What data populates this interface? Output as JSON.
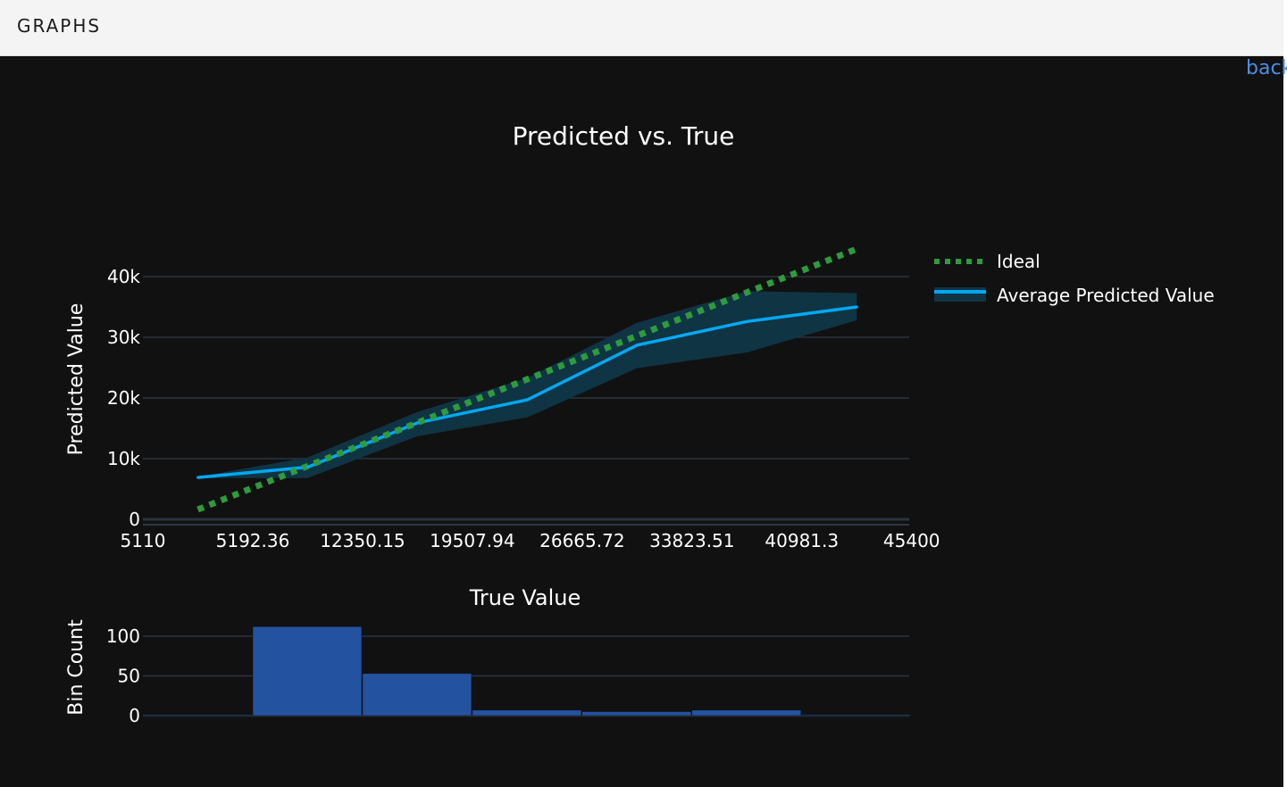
{
  "header": {
    "title": "GRAPHS"
  },
  "nav": {
    "back_label": "back"
  },
  "colors": {
    "background": "#111111",
    "ideal": "#2e9b3e",
    "predicted": "#00a8f3",
    "band": "#0f3443",
    "bars": "#2352a0",
    "grid": "#2a3441",
    "text": "#ffffff"
  },
  "chart_data": [
    {
      "type": "line",
      "title": "Predicted vs. True",
      "xlabel": "",
      "ylabel": "Predicted Value",
      "xlim": [
        -1967.79,
        47980.7
      ],
      "ylim": [
        0,
        40000
      ],
      "x_tick_values": [
        -1967.79,
        5192.36,
        12350.15,
        19507.94,
        26665.72,
        33823.51,
        40981.3,
        48139.09
      ],
      "x_tick_labels": [
        "5110",
        "5192.36",
        "12350.15",
        "19507.94",
        "26665.72",
        "33823.51",
        "40981.3",
        "45400"
      ],
      "y_ticks": [
        0,
        10000,
        20000,
        30000,
        40000
      ],
      "y_tick_labels": [
        "0",
        "10k",
        "20k",
        "30k",
        "40k"
      ],
      "grid": true,
      "legend_position": "right",
      "series": [
        {
          "name": "Ideal",
          "style": "dotted",
          "x": [
            1612,
            44560
          ],
          "y": [
            1612,
            44560
          ]
        },
        {
          "name": "Average Predicted Value",
          "style": "solid",
          "x": [
            1612,
            8771,
            15929,
            23087,
            30245,
            37402,
            44560
          ],
          "y": [
            6900,
            8600,
            15900,
            19700,
            28700,
            32600,
            35000
          ],
          "band_upper": [
            7000,
            10200,
            17700,
            23300,
            32400,
            37600,
            37300
          ],
          "band_lower": [
            6800,
            6800,
            13700,
            16800,
            24900,
            27500,
            32800
          ]
        }
      ]
    },
    {
      "type": "bar",
      "title": "True Value",
      "ylabel": "Bin Count",
      "ylim": [
        0,
        100
      ],
      "y_ticks": [
        0,
        50,
        100
      ],
      "bin_edges": [
        -1967.79,
        5192.36,
        12350.15,
        19507.94,
        26665.72,
        33823.51,
        40981.3,
        48139.09
      ],
      "values": [
        1,
        112,
        53,
        7,
        5,
        7,
        1
      ]
    }
  ]
}
